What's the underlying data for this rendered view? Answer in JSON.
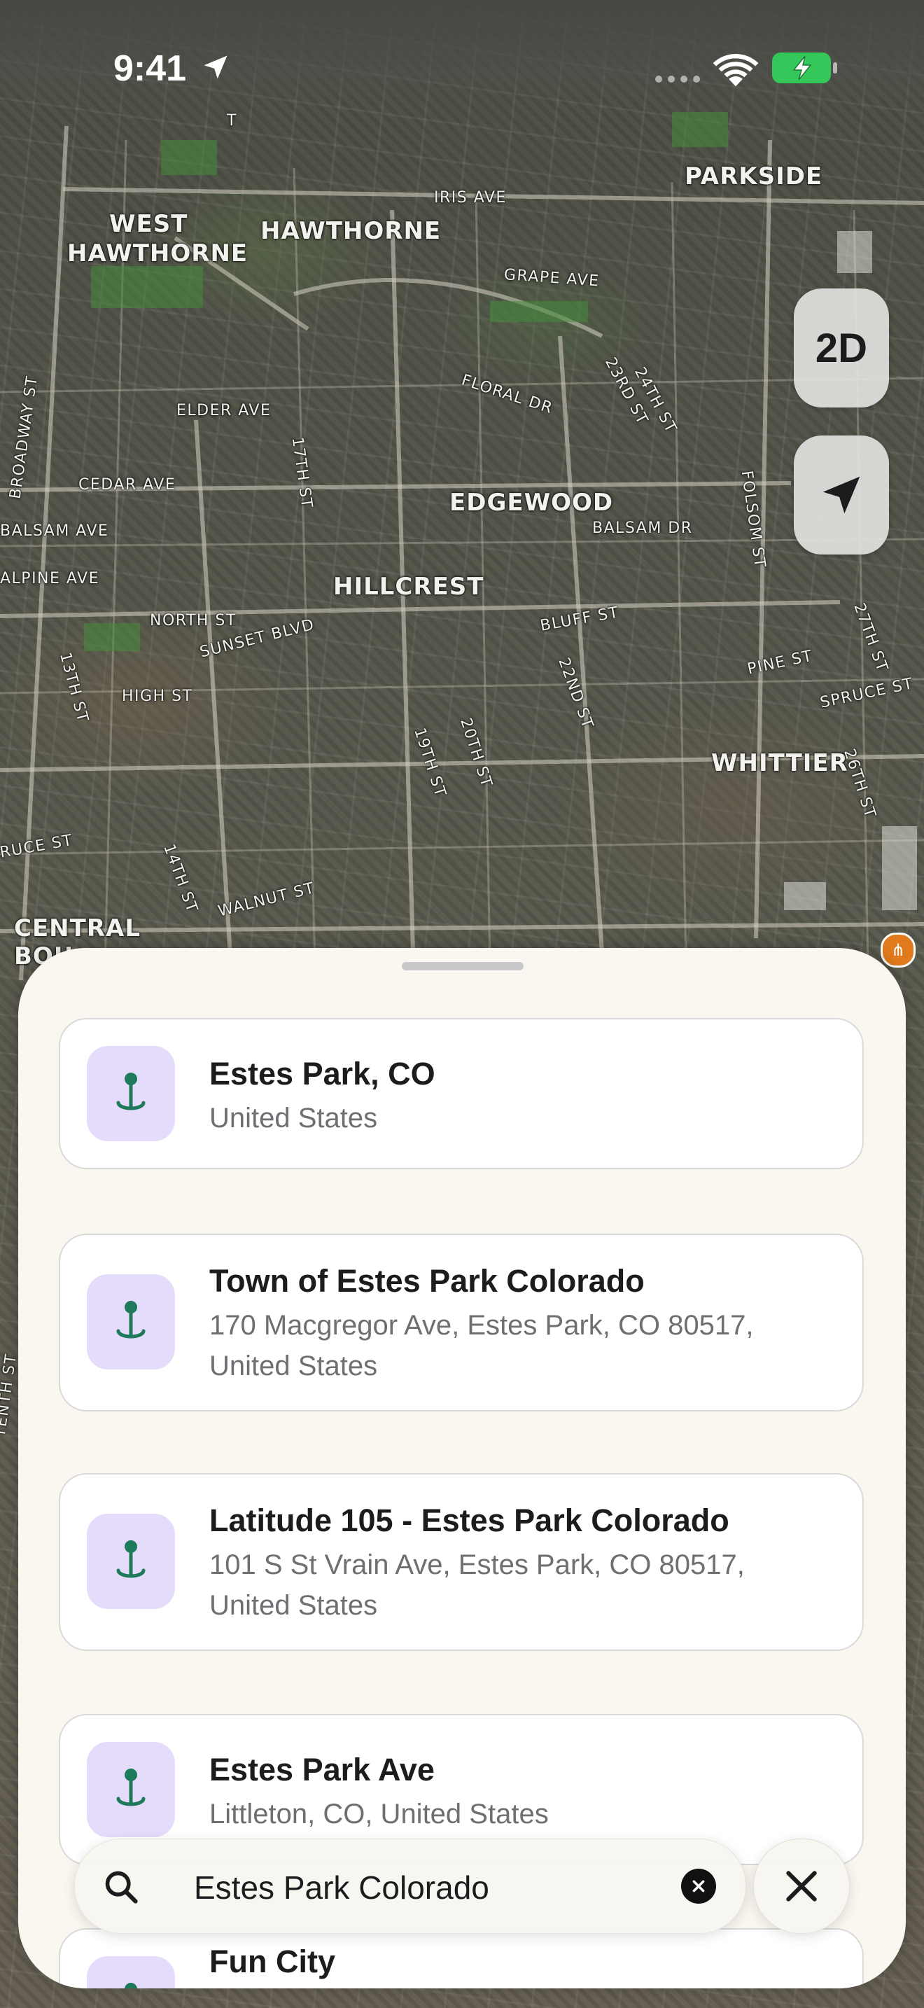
{
  "status_bar": {
    "time": "9:41",
    "icons": [
      "location-arrow-icon",
      "cellular-dots-icon",
      "wifi-icon",
      "battery-charging-icon"
    ]
  },
  "map": {
    "style": "satellite",
    "neighborhood_labels": [
      "PARKSIDE",
      "WEST",
      "HAWTHORNE",
      "HAWTHORNE",
      "EDGEWOOD",
      "HILLCREST",
      "WHITTIER",
      "CENTRAL",
      "BOU"
    ],
    "street_labels": [
      "IRIS AVE",
      "GRAPE AVE",
      "FLORAL DR",
      "23RD ST",
      "24TH ST",
      "BROADWAY ST",
      "ELDER AVE",
      "17TH ST",
      "CEDAR AVE",
      "BALSAM AVE",
      "BALSAM DR",
      "FOLSOM ST",
      "ALPINE AVE",
      "NORTH ST",
      "SUNSET BLVD",
      "BLUFF ST",
      "22ND ST",
      "PINE ST",
      "27TH ST",
      "SPRUCE ST",
      "13TH ST",
      "HIGH ST",
      "19TH ST",
      "20TH ST",
      "26TH ST",
      "RUCE ST",
      "14TH ST",
      "WALNUT ST",
      "TENTH ST",
      "T"
    ],
    "controls": {
      "view_mode_label": "2D",
      "locate_icon": "location-arrow-icon"
    }
  },
  "results": [
    {
      "title": "Estes Park, CO",
      "subtitle": "United States",
      "icon": "map-pin-icon"
    },
    {
      "title": "Town of Estes Park Colorado",
      "subtitle": "170 Macgregor Ave, Estes Park, CO  80517, United States",
      "icon": "map-pin-icon"
    },
    {
      "title": "Latitude 105 - Estes Park Colorado",
      "subtitle": "101 S St Vrain Ave, Estes Park, CO  80517, United States",
      "icon": "map-pin-icon"
    },
    {
      "title": "Estes Park Ave",
      "subtitle": "Littleton, CO, United States",
      "icon": "map-pin-icon"
    },
    {
      "title": "Fun City",
      "subtitle": "",
      "icon": "map-pin-icon"
    }
  ],
  "search": {
    "query": "Estes Park Colorado",
    "icon": "search-icon",
    "clear_icon": "clear-x-circle-icon",
    "close_icon": "close-icon"
  },
  "colors": {
    "sheet_bg": "#f9f7f0",
    "pin_icon_bg": "#e5dcfb",
    "pin_color": "#1f7a5c",
    "poi_orange": "#e07a1c"
  }
}
